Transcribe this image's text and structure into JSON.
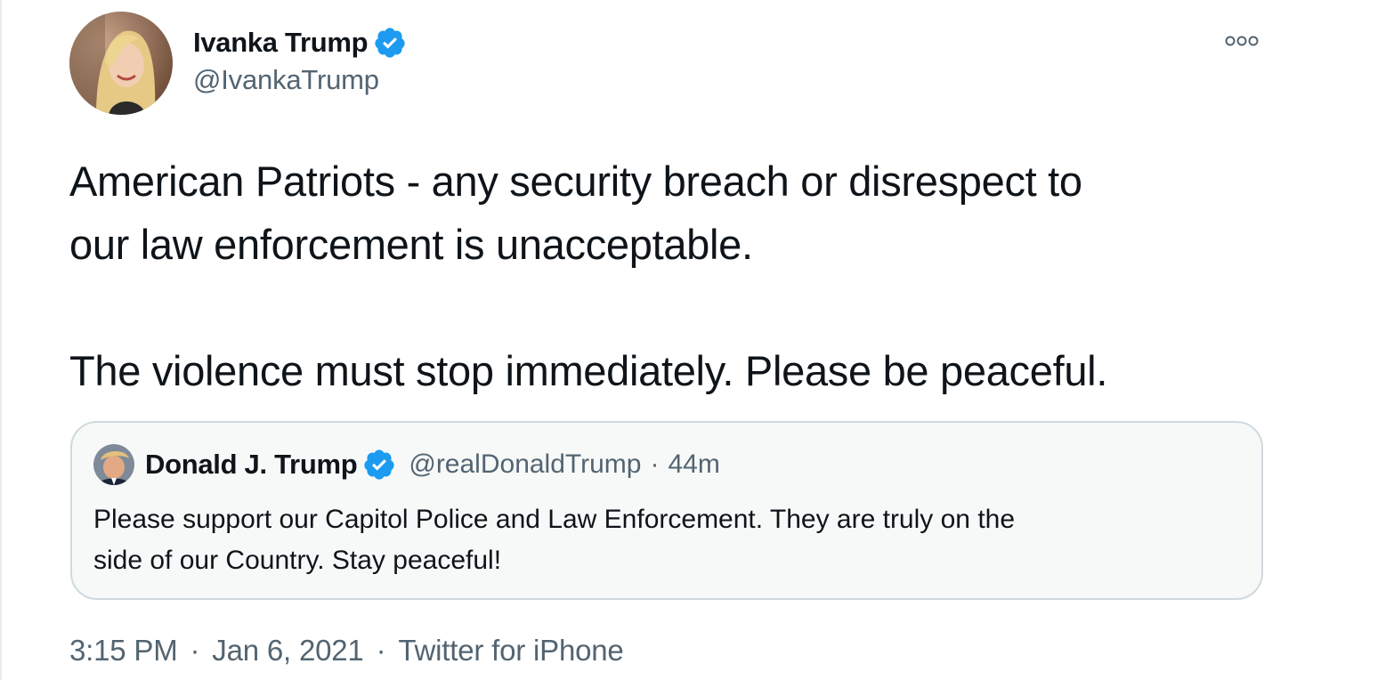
{
  "tweet": {
    "author": {
      "name": "Ivanka Trump",
      "handle": "@IvankaTrump",
      "verified": true
    },
    "text_lines": [
      "American Patriots - any security breach or disrespect to",
      "our law enforcement is unacceptable.",
      "The violence must stop immediately. Please be peaceful."
    ],
    "quoted": {
      "name": "Donald J. Trump",
      "handle": "@realDonaldTrump",
      "separator": "·",
      "time": "44m",
      "text_lines": [
        "Please support our Capitol Police and Law Enforcement. They are truly on the",
        "side of our Country. Stay peaceful!"
      ]
    },
    "meta": {
      "time": "3:15 PM",
      "separator": "·",
      "date": "Jan 6, 2021",
      "source": "Twitter for iPhone"
    }
  },
  "icons": {
    "verified": "verified-badge-icon",
    "more": "more-options-icon"
  },
  "colors": {
    "verified": "#1d9bf0",
    "secondary_text": "#536471",
    "primary_text": "#0f1419",
    "border": "#cfd9de"
  }
}
